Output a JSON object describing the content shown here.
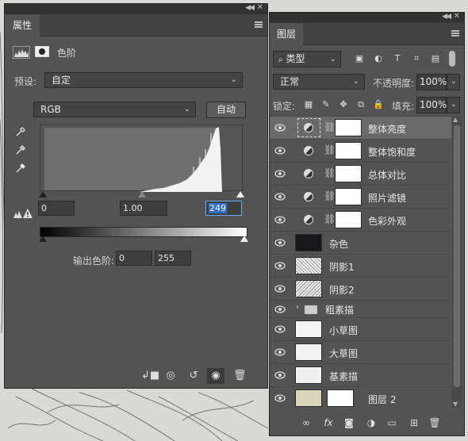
{
  "properties_panel": {
    "tab_label": "属性",
    "header_title": "色阶",
    "preset": {
      "label": "预设:",
      "value": "自定"
    },
    "channel": {
      "value": "RGB"
    },
    "auto_label": "自动",
    "input_levels": {
      "black": "0",
      "gamma": "1.00",
      "white": "249"
    },
    "output_label": "输出色阶:",
    "output_levels": {
      "black": "0",
      "white": "255"
    },
    "footer_icons": [
      "clip-to-layer-icon",
      "view-previous-state-icon",
      "reset-icon",
      "visibility-eye-icon",
      "trash-icon"
    ]
  },
  "layers_panel": {
    "tab_label": "图层",
    "filter": {
      "value": "类型",
      "icons": [
        "image-filter-icon",
        "adjustment-filter-icon",
        "type-filter-icon",
        "shape-filter-icon",
        "smart-object-filter-icon"
      ]
    },
    "blend_mode": "正常",
    "opacity": {
      "label": "不透明度:",
      "value": "100%"
    },
    "lock_label": "锁定:",
    "fill": {
      "label": "填充:",
      "value": "100%"
    },
    "layers": [
      {
        "name": "整体亮度",
        "kind": "adjustment",
        "selected": true
      },
      {
        "name": "整体饱和度",
        "kind": "adjustment",
        "selected": false
      },
      {
        "name": "总体对比",
        "kind": "adjustment",
        "selected": false
      },
      {
        "name": "照片滤镜",
        "kind": "adjustment",
        "selected": false
      },
      {
        "name": "色彩外观",
        "kind": "adjustment",
        "selected": false
      },
      {
        "name": "杂色",
        "kind": "pixel-dark",
        "selected": false
      },
      {
        "name": "阴影1",
        "kind": "pixel-texture",
        "selected": false
      },
      {
        "name": "阴影2",
        "kind": "pixel-texture",
        "selected": false
      },
      {
        "name": "粗素描",
        "kind": "group",
        "selected": false
      },
      {
        "name": "小草图",
        "kind": "pixel-light",
        "selected": false
      },
      {
        "name": "大草图",
        "kind": "pixel-light",
        "selected": false
      },
      {
        "name": "基素描",
        "kind": "pixel-light",
        "selected": false
      },
      {
        "name": "图层 2",
        "kind": "pixel-beige-with-mask",
        "selected": false
      }
    ],
    "footer_icons": [
      "link-layers-icon",
      "fx-icon",
      "add-mask-icon",
      "new-adjustment-icon",
      "new-group-icon",
      "new-layer-icon",
      "trash-icon"
    ]
  }
}
